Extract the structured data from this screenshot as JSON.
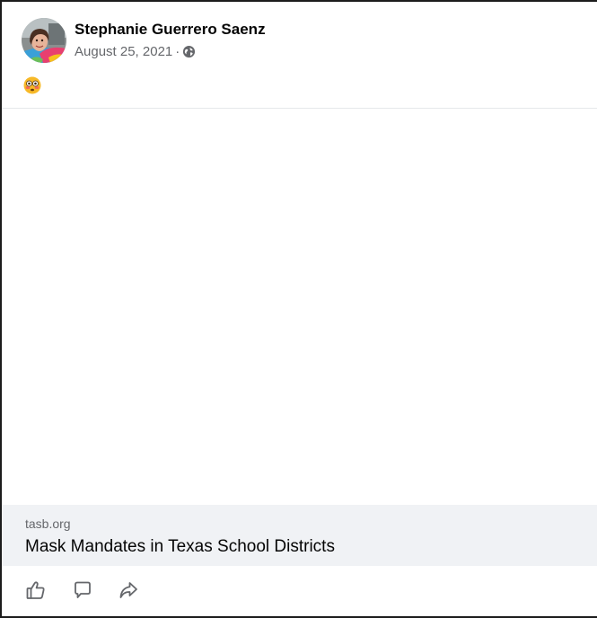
{
  "post": {
    "author": "Stephanie Guerrero Saenz",
    "date": "August 25, 2021",
    "separator": "·",
    "privacy_icon": "globe-icon",
    "emoji": "flushed-face-emoji"
  },
  "link_preview": {
    "domain": "tasb.org",
    "title": "Mask Mandates in Texas School Districts"
  },
  "actions": {
    "like_icon": "like-icon",
    "comment_icon": "comment-icon",
    "share_icon": "share-icon"
  },
  "colors": {
    "text_primary": "#050505",
    "text_secondary": "#65676b",
    "preview_bg": "#f0f2f5"
  }
}
